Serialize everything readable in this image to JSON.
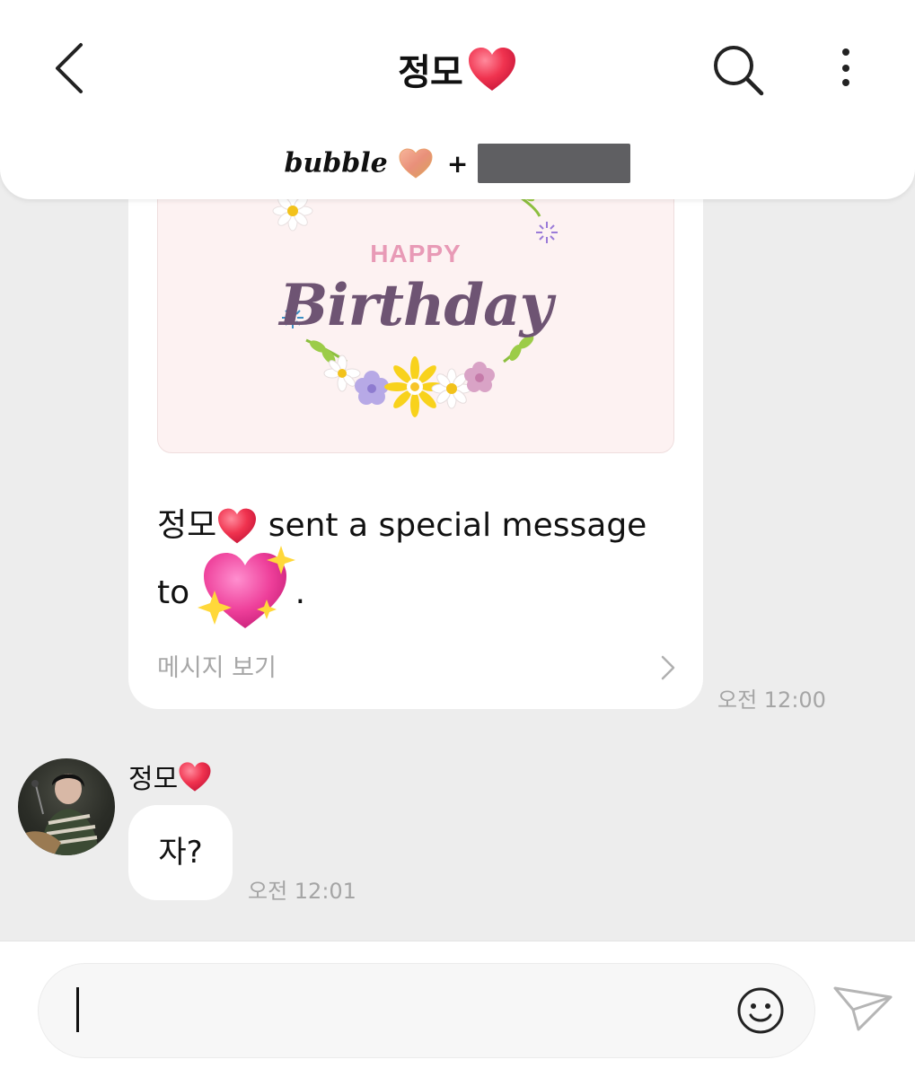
{
  "header": {
    "title": "정모",
    "brand_word": "bubble",
    "brand_plus": "+"
  },
  "special_card": {
    "image_happy": "HAPPY",
    "image_birthday": "Birthday",
    "sender": "정모",
    "message_part1": "sent a special message",
    "message_part2": "to",
    "message_end": ".",
    "view_label": "메시지 보기",
    "time": "오전 12:00"
  },
  "incoming": {
    "sender_name": "정모",
    "text": "자?",
    "time": "오전 12:01"
  },
  "input": {
    "value": "",
    "placeholder": ""
  },
  "colors": {
    "background": "#ededed",
    "bubble": "#ffffff",
    "heart_red": "#ee2b4b",
    "heart_pink": "#ee3f8f",
    "timestamp": "#a5a5a5",
    "birthday_purple": "#6e5473",
    "happy_pink": "#e89ab6"
  },
  "icons": [
    "back-arrow-icon",
    "red-heart-icon",
    "search-icon",
    "more-vertical-icon",
    "gold-heart-icon",
    "sparkling-heart-icon",
    "chevron-right-icon",
    "smiley-icon",
    "send-icon"
  ]
}
